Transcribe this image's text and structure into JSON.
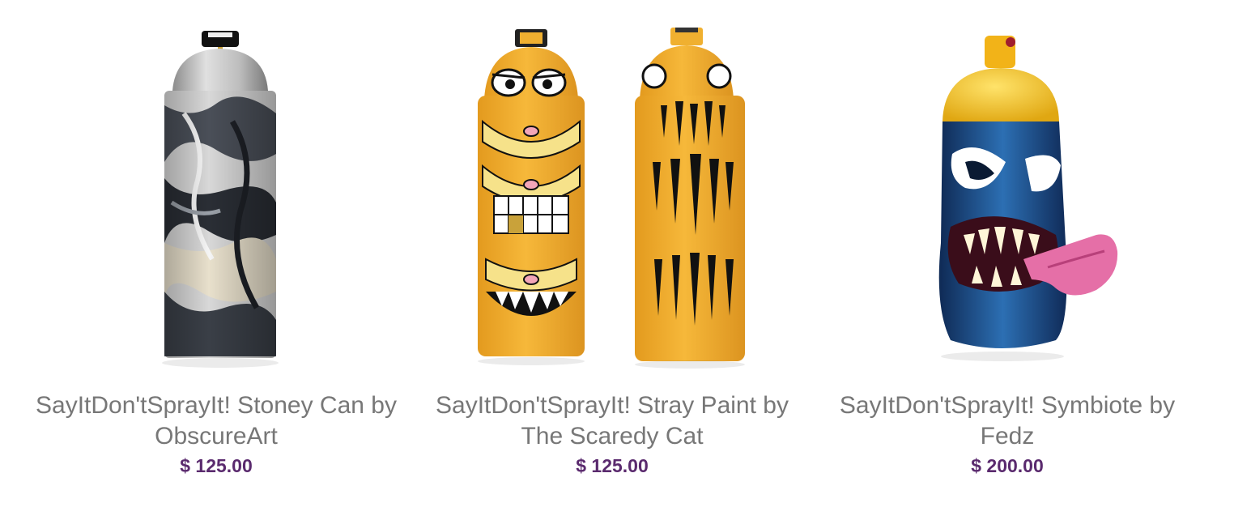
{
  "theme": {
    "price_color": "#5a2a6e",
    "title_color": "#777777"
  },
  "products": [
    {
      "title": "SayItDon'tSprayIt! Stoney Can by ObscureArt",
      "price": "$ 125.00",
      "image": "marbled-spray-can-photo"
    },
    {
      "title": "SayItDon'tSprayIt! Stray Paint by The Scaredy Cat",
      "price": "$ 125.00",
      "image": "yellow-cat-spray-cans-photo"
    },
    {
      "title": "SayItDon'tSprayIt! Symbiote by Fedz",
      "price": "$ 200.00",
      "image": "blue-monster-spray-can-photo"
    }
  ]
}
